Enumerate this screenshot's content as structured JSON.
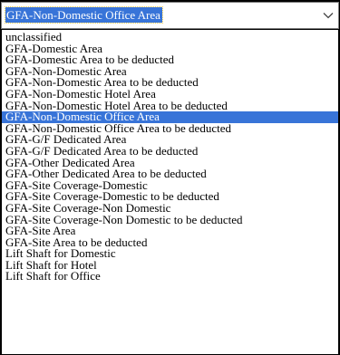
{
  "select": {
    "value": "GFA-Non-Domestic Office Area",
    "icon": "chevron-down-icon"
  },
  "options": [
    {
      "label": "unclassified",
      "selected": false
    },
    {
      "label": "GFA-Domestic Area",
      "selected": false
    },
    {
      "label": "GFA-Domestic Area to be deducted",
      "selected": false
    },
    {
      "label": "GFA-Non-Domestic Area",
      "selected": false
    },
    {
      "label": "GFA-Non-Domestic Area to be deducted",
      "selected": false
    },
    {
      "label": "GFA-Non-Domestic Hotel Area",
      "selected": false
    },
    {
      "label": "GFA-Non-Domestic Hotel Area to be deducted",
      "selected": false
    },
    {
      "label": "GFA-Non-Domestic Office Area",
      "selected": true
    },
    {
      "label": "GFA-Non-Domestic Office Area to be deducted",
      "selected": false
    },
    {
      "label": "GFA-G/F Dedicated Area",
      "selected": false
    },
    {
      "label": "GFA-G/F Dedicated Area to be deducted",
      "selected": false
    },
    {
      "label": "GFA-Other Dedicated Area",
      "selected": false
    },
    {
      "label": "GFA-Other Dedicated Area to be deducted",
      "selected": false
    },
    {
      "label": "GFA-Site Coverage-Domestic",
      "selected": false
    },
    {
      "label": "GFA-Site Coverage-Domestic to be deducted",
      "selected": false
    },
    {
      "label": "GFA-Site Coverage-Non Domestic",
      "selected": false
    },
    {
      "label": "GFA-Site Coverage-Non Domestic to be deducted",
      "selected": false
    },
    {
      "label": "GFA-Site Area",
      "selected": false
    },
    {
      "label": "GFA-Site Area to be deducted",
      "selected": false
    },
    {
      "label": "Lift Shaft for Domestic",
      "selected": false
    },
    {
      "label": "Lift Shaft for Hotel",
      "selected": false
    },
    {
      "label": "Lift Shaft for Office",
      "selected": false
    }
  ],
  "colors": {
    "highlight": "#3874d8",
    "focus_outline": "#ffd24a",
    "background": "#000000"
  }
}
